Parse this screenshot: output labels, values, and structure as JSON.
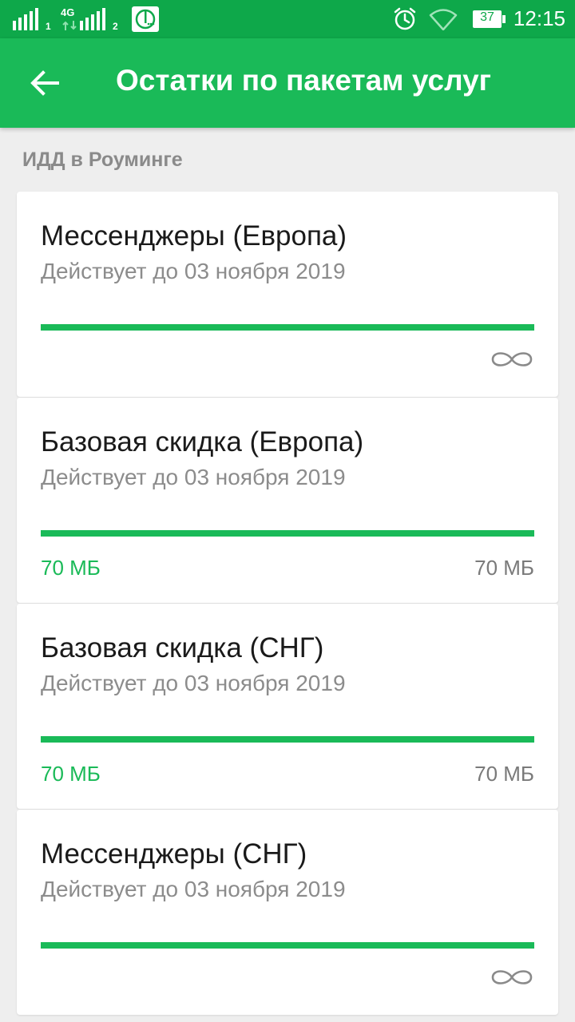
{
  "status_bar": {
    "sim1_label": "1",
    "sim2_label": "2",
    "network_type": "4G",
    "battery_level": "37",
    "time": "12:15",
    "icons": [
      "signal-icon",
      "signal-icon",
      "operator-icon",
      "alarm-icon",
      "wifi-icon",
      "battery-icon"
    ]
  },
  "app_bar": {
    "back_icon": "arrow-back-icon",
    "title": "Остатки по пакетам услуг"
  },
  "section": {
    "title": "ИДД в Роуминге"
  },
  "colors": {
    "status_bar": "#0ea84a",
    "app_bar": "#1aba58",
    "accent": "#1aba58",
    "background": "#eeeeee",
    "secondary_text": "#8c8c8c"
  },
  "packages": [
    {
      "title": "Мессенджеры (Европа)",
      "subtitle": "Действует до 03 ноября 2019",
      "progress_percent": 100,
      "unlimited": true,
      "remaining": "",
      "total": ""
    },
    {
      "title": "Базовая скидка (Европа)",
      "subtitle": "Действует до 03 ноября 2019",
      "progress_percent": 100,
      "unlimited": false,
      "remaining": "70 МБ",
      "total": "70 МБ"
    },
    {
      "title": "Базовая скидка (СНГ)",
      "subtitle": "Действует до 03 ноября 2019",
      "progress_percent": 100,
      "unlimited": false,
      "remaining": "70 МБ",
      "total": "70 МБ"
    },
    {
      "title": "Мессенджеры (СНГ)",
      "subtitle": "Действует до 03 ноября 2019",
      "progress_percent": 100,
      "unlimited": true,
      "remaining": "",
      "total": ""
    }
  ]
}
